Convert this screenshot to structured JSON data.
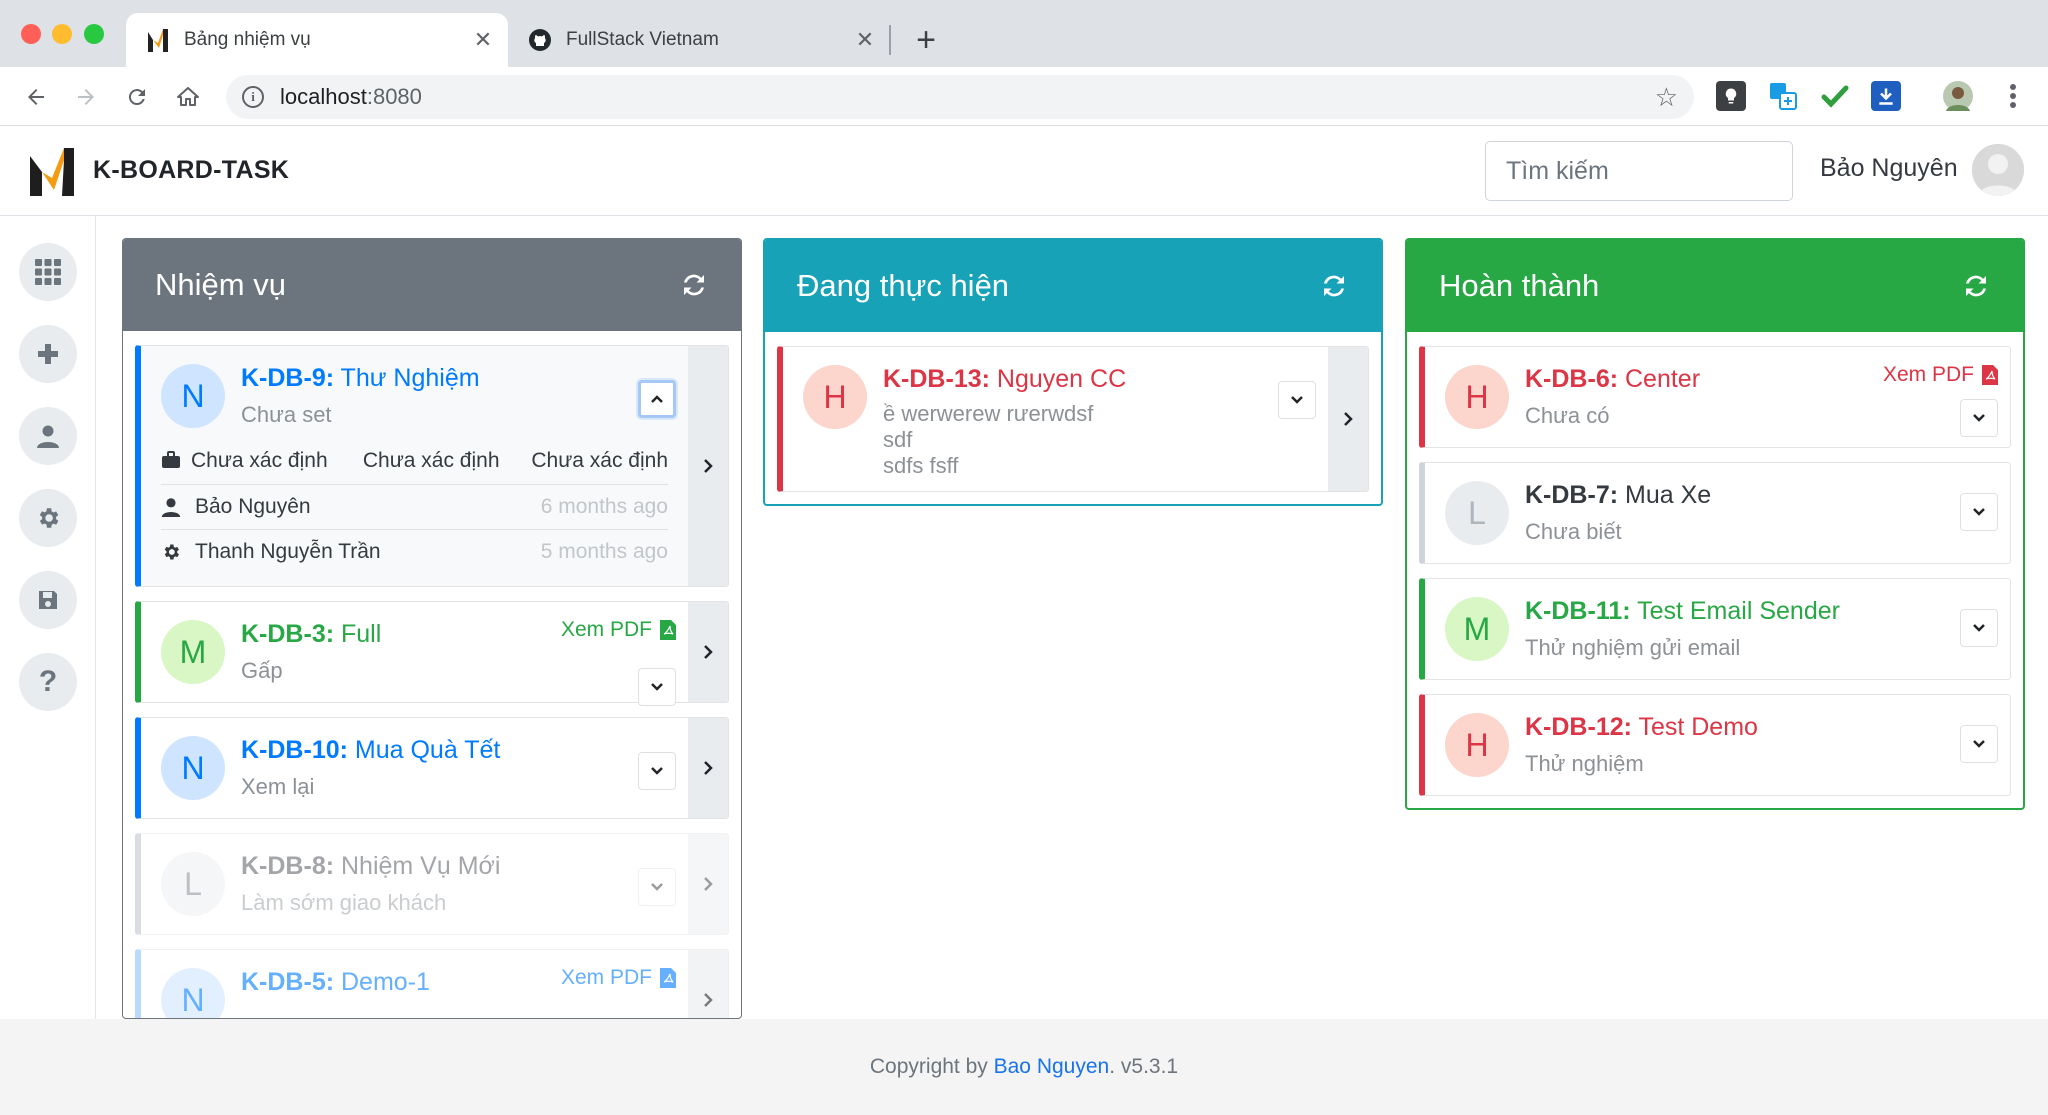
{
  "browser": {
    "tabs": [
      {
        "title": "Bảng nhiệm vụ",
        "active": true
      },
      {
        "title": "FullStack Vietnam",
        "active": false
      }
    ],
    "url_host": "localhost",
    "url_port": ":8080"
  },
  "header": {
    "brand": "K-BOARD-TASK",
    "search_placeholder": "Tìm kiếm",
    "user_name": "Bảo Nguyên"
  },
  "sidebar": {
    "items": [
      "apps-icon",
      "plus-icon",
      "user-icon",
      "gear-icon",
      "save-icon",
      "help-icon"
    ]
  },
  "columns": [
    {
      "title": "Nhiệm vụ",
      "color": "#6c757d",
      "cards": [
        {
          "code": "K-DB-9:",
          "name": "Thư Nghiệm",
          "sub": "Chưa set",
          "badge": "N",
          "color": "#007bff",
          "meta": {
            "type": "Chưa xác định",
            "field2": "Chưa xác định",
            "field3": "Chưa xác định",
            "creator": "Bảo Nguyên",
            "created": "6 months ago",
            "assignee": "Thanh Nguyễn Trần",
            "updated": "5 months ago"
          }
        },
        {
          "code": "K-DB-3:",
          "name": "Full",
          "sub": "Gấp",
          "badge": "M",
          "color": "#28a745",
          "pdf": "Xem PDF"
        },
        {
          "code": "K-DB-10:",
          "name": "Mua Quà Tết",
          "sub": "Xem lại",
          "badge": "N",
          "color": "#007bff"
        },
        {
          "code": "K-DB-8:",
          "name": "Nhiệm Vụ Mới",
          "sub": "Làm sớm giao khách",
          "badge": "L",
          "color": "#6c757d"
        },
        {
          "code": "K-DB-5:",
          "name": "Demo-1",
          "sub": "",
          "badge": "N",
          "color": "#007bff",
          "pdf": "Xem PDF"
        }
      ]
    },
    {
      "title": "Đang thực hiện",
      "color": "#17a2b8",
      "cards": [
        {
          "code": "K-DB-13:",
          "name": "Nguyen CC",
          "sub_lines": [
            "ề werwerew rưerwdsf",
            "sdf",
            "sdfs fsff"
          ],
          "badge": "H",
          "color": "#dc3545"
        }
      ]
    },
    {
      "title": "Hoàn thành",
      "color": "#28a745",
      "cards": [
        {
          "code": "K-DB-6:",
          "name": "Center",
          "sub": "Chưa có",
          "badge": "H",
          "color": "#dc3545",
          "pdf": "Xem PDF"
        },
        {
          "code": "K-DB-7:",
          "name": "Mua Xe",
          "sub": "Chưa biết",
          "badge": "L",
          "color": "#343a40"
        },
        {
          "code": "K-DB-11:",
          "name": "Test Email Sender",
          "sub": "Thử nghiệm gửi email",
          "badge": "M",
          "color": "#28a745"
        },
        {
          "code": "K-DB-12:",
          "name": "Test Demo",
          "sub": "Thử nghiệm",
          "badge": "H",
          "color": "#dc3545"
        }
      ]
    }
  ],
  "footer": {
    "prefix": "Copyright by",
    "author": "Bao Nguyen",
    "version": ". v5.3.1"
  }
}
